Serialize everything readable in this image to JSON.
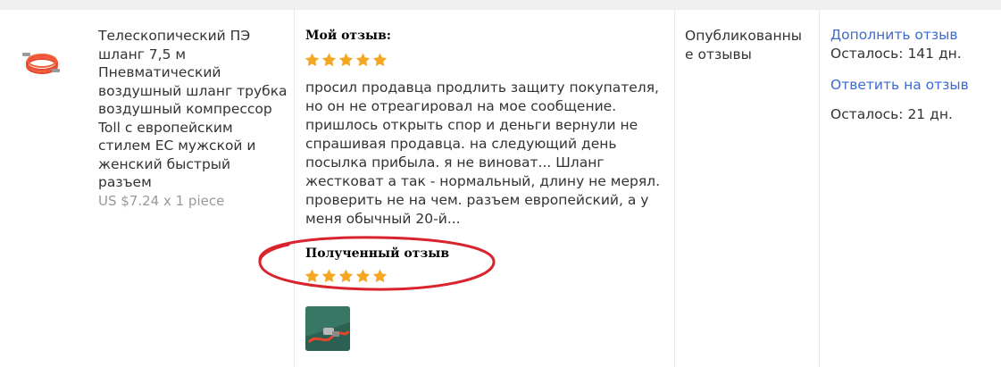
{
  "product": {
    "title": "Телескопический ПЭ шланг 7,5 м Пневматический воздушный шланг трубка воздушный компрессор Toll с европейским стилем EC мужской и женский быстрый разъем",
    "price": "US $7.24 x 1 piece"
  },
  "my_review": {
    "heading": "Мой отзыв:",
    "rating": 5,
    "text": "просил продавца продлить защиту покупателя, но он не отреагировал на мое сообщение. пришлось открыть спор и деньги вернули не спрашивая продавца. на следующий день посылка прибыла. я не виноват... Шланг жестковат а так - нормальный, длину не мерял. проверить не на чем. разъем европейский, а у меня обычный 20-й..."
  },
  "received_review": {
    "heading": "Полученный отзыв",
    "rating": 5
  },
  "status": {
    "text": "Опубликованные отзывы"
  },
  "actions": {
    "add_review_link": "Дополнить отзыв",
    "add_review_remaining": "Осталось: 141 дн.",
    "reply_link": "Ответить на отзыв",
    "reply_remaining": "Осталось: 21 дн."
  },
  "colors": {
    "star": "#f5a623",
    "link": "#3b6ad0",
    "highlight_circle": "#d9232d",
    "price": "#999999"
  },
  "icons": {
    "star": "star-icon",
    "thumbnail": "air-hose-thumbnail",
    "photo": "review-photo-thumbnail"
  }
}
